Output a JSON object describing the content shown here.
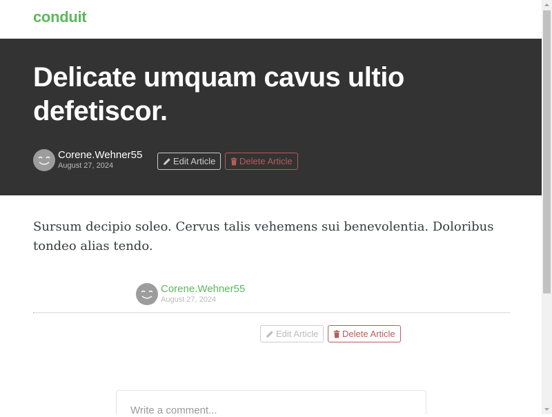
{
  "navbar": {
    "brand": "conduit"
  },
  "article": {
    "title": "Delicate umquam cavus ultio defetiscor.",
    "author": "Corene.Wehner55",
    "date": "August 27, 2024",
    "body": "Sursum decipio soleo. Cervus talis vehemens sui benevolentia. Doloribus tondeo alias tendo."
  },
  "actions": {
    "edit_label": "Edit Article",
    "delete_label": "Delete Article"
  },
  "comment": {
    "placeholder": "Write a comment..."
  },
  "icons": {
    "edit": "pencil-icon",
    "delete": "trash-icon",
    "avatar": "smiley-avatar"
  },
  "colors": {
    "brand": "#5cb85c",
    "banner": "#333333",
    "danger": "#b85c5c"
  }
}
